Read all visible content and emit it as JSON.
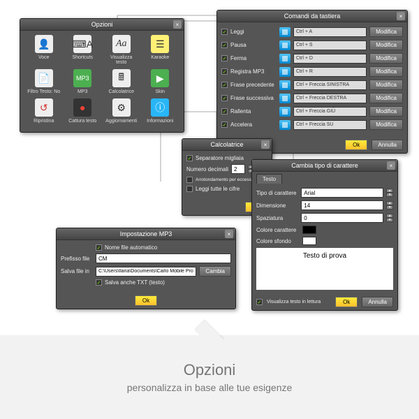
{
  "footer": {
    "title": "Opzioni",
    "subtitle": "personalizza in base alle tue esigenze"
  },
  "common": {
    "ok": "Ok",
    "cancel": "Annulla",
    "change": "Cambia",
    "modify": "Modifica"
  },
  "opzioni": {
    "title": "Opzioni",
    "icons": [
      {
        "glyph": "👤",
        "label": "Voce"
      },
      {
        "glyph": "⌨A",
        "label": "Shortcuts"
      },
      {
        "glyph": "Aa",
        "label": "Visualizza testo"
      },
      {
        "glyph": "☰",
        "label": "Karaoke"
      },
      {
        "glyph": "📄",
        "label": "Filtro Testo: No"
      },
      {
        "glyph": "MP3",
        "label": "MP3"
      },
      {
        "glyph": "🖩",
        "label": "Calcolatrice"
      },
      {
        "glyph": "▶",
        "label": "Skin"
      },
      {
        "glyph": "↺",
        "label": "Ripristina"
      },
      {
        "glyph": "●",
        "label": "Cattura testo"
      },
      {
        "glyph": "⚙",
        "label": "Aggiornamenti"
      },
      {
        "glyph": "ⓘ",
        "label": "Informazioni"
      }
    ]
  },
  "tastiera": {
    "title": "Comandi da tastiera",
    "rows": [
      {
        "label": "Leggi",
        "combo": "Ctrl + A"
      },
      {
        "label": "Pausa",
        "combo": "Ctrl + S"
      },
      {
        "label": "Ferma",
        "combo": "Ctrl + D"
      },
      {
        "label": "Registra MP3",
        "combo": "Ctrl + R"
      },
      {
        "label": "Frase precedente",
        "combo": "Ctrl + Freccia SINISTRA"
      },
      {
        "label": "Frase successiva",
        "combo": "Ctrl + Freccia DESTRA"
      },
      {
        "label": "Rallenta",
        "combo": "Ctrl + Freccia GIÙ"
      },
      {
        "label": "Accelera",
        "combo": "Ctrl + Freccia SU"
      }
    ]
  },
  "calc": {
    "title": "Calcolatrice",
    "sep": "Separatore migliaia",
    "dec_label": "Numero decimali",
    "dec_value": "2",
    "round": "Arrotondamento per eccesso",
    "readall": "Leggi tutte le cifre"
  },
  "mp3": {
    "title": "Impostazione MP3",
    "auto": "Nome file automatico",
    "prefix_label": "Prefisso file",
    "prefix_value": "CM",
    "folder_label": "Salva file in",
    "folder_value": "C:\\Users\\Ilaria\\Documents\\Carlo Mobile Pro\\C",
    "save_txt": "Salva anche TXT (testo)"
  },
  "carattere": {
    "title": "Cambia tipo di carattere",
    "tab": "Testo",
    "font_label": "Tipo di carattere",
    "font_value": "Arial",
    "size_label": "Dimensione",
    "size_value": "14",
    "spacing_label": "Spaziatura",
    "spacing_value": "0",
    "char_color_label": "Colore carattere",
    "char_color": "#000000",
    "bg_color_label": "Colore sfondo",
    "bg_color": "#ffffff",
    "preview": "Testo di prova",
    "view_reading": "Visualizza testo in lettura"
  }
}
